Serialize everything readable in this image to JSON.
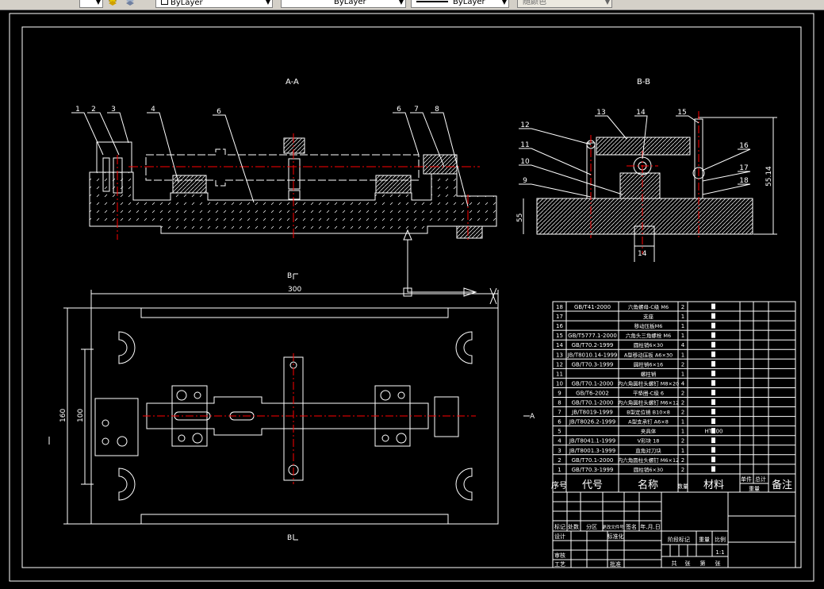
{
  "toolbar": {
    "layer_control": "ByLayer",
    "linetype_control": "ByLayer",
    "lineweight_control": "ByLayer",
    "plotstyle_control": "随颜色",
    "icons": [
      "layer-previous-icon",
      "layer-states-icon"
    ]
  },
  "colors": {
    "background": "#000000",
    "lines": "#ffffff",
    "centerlines": "#ff0000",
    "toolbar": "#d4d0c8"
  },
  "drawing": {
    "section_aa": "A-A",
    "section_bb": "B-B",
    "aa_balloons": [
      "1",
      "2",
      "3",
      "4",
      "6",
      "6",
      "7",
      "8"
    ],
    "bb_balloons": [
      "13",
      "14",
      "15",
      "12",
      "11",
      "10",
      "9",
      "16",
      "17",
      "18"
    ],
    "dim_length": "300",
    "dim_width_outer": "160",
    "dim_width_inner": "100",
    "dim_height_bb": "55.14",
    "dim_base_bb": "55",
    "dim_slot_bb": "14",
    "section_mark_b_top": "B",
    "section_mark_b_bottom": "B",
    "section_mark_a": "A"
  },
  "bom": {
    "rows": [
      [
        "18",
        "GB/T41-2000",
        "六角螺母-C级 M6",
        "2",
        "",
        ""
      ],
      [
        "17",
        "",
        "支座",
        "1",
        "",
        ""
      ],
      [
        "16",
        "",
        "移动压板M6",
        "1",
        "",
        ""
      ],
      [
        "15",
        "GB/T5777.1-2000",
        "六角头三角螺栓 M6",
        "1",
        "",
        ""
      ],
      [
        "14",
        "GB/T70.2-1999",
        "圆柱销6×30",
        "4",
        "",
        ""
      ],
      [
        "13",
        "JB/T8010.14-1999",
        "A型移动压板 A6×30",
        "1",
        "",
        ""
      ],
      [
        "12",
        "GB/T70.3-1999",
        "圆柱销6×16",
        "2",
        "",
        ""
      ],
      [
        "11",
        "",
        "螺柱销",
        "1",
        "",
        ""
      ],
      [
        "10",
        "GB/T70.1-2000",
        "内六角圆柱头螺钉 M8×20",
        "4",
        "",
        ""
      ],
      [
        "9",
        "GB/T6-2002",
        "平垫圈-C级 6",
        "2",
        "",
        ""
      ],
      [
        "8",
        "GB/T70.1-2000",
        "内六角圆柱头螺钉 M6×12",
        "2",
        "",
        ""
      ],
      [
        "7",
        "JB/T8019-1999",
        "B型定位销 B10×8",
        "2",
        "",
        ""
      ],
      [
        "6",
        "JB/T8026.2-1999",
        "A型支承钉 A6×8",
        "1",
        "",
        ""
      ],
      [
        "5",
        "",
        "夹具体",
        "1",
        "HT200",
        ""
      ],
      [
        "4",
        "JB/T8041.1-1999",
        "V形块 18",
        "2",
        "",
        ""
      ],
      [
        "3",
        "JB/T8001.3-1999",
        "直角对刀块",
        "1",
        "",
        ""
      ],
      [
        "2",
        "GB/T70.1-2000",
        "内六角圆柱头螺钉 M6×12",
        "2",
        "",
        ""
      ],
      [
        "1",
        "GB/T70.3-1999",
        "圆柱销6×30",
        "2",
        "",
        ""
      ]
    ],
    "header": {
      "no": "序号",
      "code": "代号",
      "name": "名称",
      "qty": "数量",
      "material": "材料",
      "unit": "单件",
      "total": "总计",
      "weight": "重量",
      "remark": "备注"
    }
  },
  "title_block": {
    "mark": "标记",
    "count": "处数",
    "zone": "分区",
    "change_doc": "更改文件号",
    "signature": "签名",
    "date": "年.月.日",
    "design": "设计",
    "standardize": "标准化",
    "review": "审核",
    "process": "工艺",
    "approve": "批准",
    "stage_mark": "阶段标记",
    "weight": "重量",
    "scale": "比例",
    "scale_value": "1:1",
    "sheets": "共",
    "sheet_unit": "张",
    "sheet_no": "第",
    "sheet_unit2": "张"
  }
}
